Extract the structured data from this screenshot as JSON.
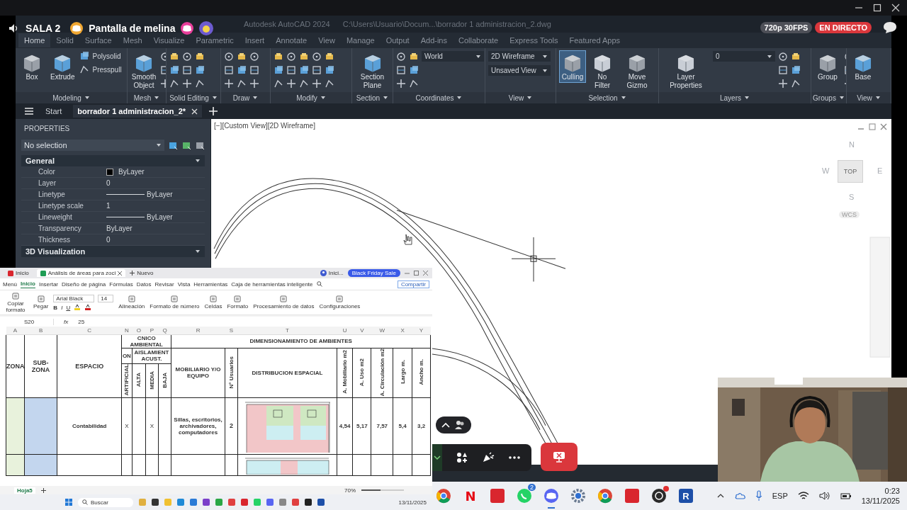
{
  "discord": {
    "room": "SALA 2",
    "stream_title": "Pantalla de melina",
    "quality": "720p 30FPS",
    "live": "EN DIRECTO"
  },
  "autocad": {
    "title": "Autodesk AutoCAD 2024",
    "path": "C:\\Users\\Usuario\\Docum...\\borrador 1 administracion_2.dwg",
    "ribbon_tabs": [
      {
        "label": "Home",
        "selected": true
      },
      {
        "label": "Solid",
        "selected": false
      },
      {
        "label": "Surface",
        "selected": false
      },
      {
        "label": "Mesh",
        "selected": false
      },
      {
        "label": "Visualize",
        "selected": false
      },
      {
        "label": "Parametric",
        "selected": false
      },
      {
        "label": "Insert",
        "selected": false
      },
      {
        "label": "Annotate",
        "selected": false
      },
      {
        "label": "View",
        "selected": false
      },
      {
        "label": "Manage",
        "selected": false
      },
      {
        "label": "Output",
        "selected": false
      },
      {
        "label": "Add-ins",
        "selected": false
      },
      {
        "label": "Collaborate",
        "selected": false
      },
      {
        "label": "Express Tools",
        "selected": false
      },
      {
        "label": "Featured Apps",
        "selected": false
      }
    ],
    "panels": [
      {
        "title": "Modeling",
        "items": [
          {
            "kind": "large",
            "label": "Box",
            "on": false
          },
          {
            "kind": "large",
            "label": "Extrude",
            "on": false
          },
          {
            "kind": "small",
            "label": "Polysolid"
          },
          {
            "kind": "small",
            "label": "Presspull"
          }
        ]
      },
      {
        "title": "Mesh",
        "items": [
          {
            "kind": "large",
            "label": "Smooth Object",
            "on": false
          },
          {
            "kind": "tools"
          }
        ]
      },
      {
        "title": "Solid Editing",
        "items": [
          {
            "kind": "tools"
          },
          {
            "kind": "tools"
          },
          {
            "kind": "tools"
          }
        ]
      },
      {
        "title": "Draw",
        "items": [
          {
            "kind": "tools"
          },
          {
            "kind": "tools"
          },
          {
            "kind": "tools"
          }
        ]
      },
      {
        "title": "Modify",
        "items": [
          {
            "kind": "tools"
          },
          {
            "kind": "tools"
          },
          {
            "kind": "tools"
          },
          {
            "kind": "tools"
          },
          {
            "kind": "tools"
          }
        ]
      },
      {
        "title": "Section",
        "items": [
          {
            "kind": "large",
            "label": "Section Plane",
            "on": false
          }
        ]
      },
      {
        "title": "Coordinates",
        "items": [
          {
            "kind": "tools"
          },
          {
            "kind": "tools"
          },
          {
            "kind": "dropdown",
            "label": "World"
          }
        ]
      },
      {
        "title": "View",
        "items": [
          {
            "kind": "dropdown",
            "label": "2D Wireframe"
          },
          {
            "kind": "dropdown",
            "label": "Unsaved View"
          }
        ]
      },
      {
        "title": "Selection",
        "items": [
          {
            "kind": "large",
            "label": "Culling",
            "on": true
          },
          {
            "kind": "large",
            "label": "No Filter",
            "on": false
          },
          {
            "kind": "large",
            "label": "Move Gizmo",
            "on": false
          }
        ]
      },
      {
        "title": "Layers",
        "items": [
          {
            "kind": "large",
            "label": "Layer Properties",
            "on": false
          },
          {
            "kind": "dropdown",
            "label": "0"
          },
          {
            "kind": "tools"
          },
          {
            "kind": "tools"
          }
        ]
      },
      {
        "title": "Groups",
        "items": [
          {
            "kind": "large",
            "label": "Group",
            "on": false
          },
          {
            "kind": "tools"
          }
        ]
      },
      {
        "title": "View",
        "items": [
          {
            "kind": "large",
            "label": "Base",
            "on": false
          }
        ]
      }
    ],
    "file_tabs": [
      {
        "label": "Start",
        "selected": false
      },
      {
        "label": "borrador 1 administracion_2*",
        "selected": true
      }
    ],
    "properties": {
      "title": "PROPERTIES",
      "selection": "No selection",
      "sections": [
        {
          "title": "General",
          "rows": [
            {
              "name": "Color",
              "value": "ByLayer",
              "kind": "swatch"
            },
            {
              "name": "Layer",
              "value": "0",
              "kind": "plain"
            },
            {
              "name": "Linetype",
              "value": "ByLayer",
              "kind": "line"
            },
            {
              "name": "Linetype scale",
              "value": "1",
              "kind": "plain"
            },
            {
              "name": "Lineweight",
              "value": "ByLayer",
              "kind": "line"
            },
            {
              "name": "Transparency",
              "value": "ByLayer",
              "kind": "plain"
            },
            {
              "name": "Thickness",
              "value": "0",
              "kind": "plain"
            }
          ]
        },
        {
          "title": "3D Visualization"
        }
      ]
    },
    "viewport": {
      "label": "[−][Custom View][2D Wireframe]",
      "compass": {
        "north": "N",
        "west": "W",
        "east": "E",
        "south": "S",
        "face": "TOP",
        "ucs": "WCS"
      }
    }
  },
  "sheet": {
    "tabs": [
      {
        "label": "Inicio",
        "selected": false
      },
      {
        "label": "Análisis de áreas para zoci",
        "selected": true
      }
    ],
    "new_tab": "Nuevo",
    "user": "Inici...",
    "promo": "Black Friday Sale",
    "menu": "Menú",
    "ribbon_tabs": [
      {
        "label": "Inicio",
        "selected": true
      },
      {
        "label": "Insertar",
        "selected": false
      },
      {
        "label": "Diseño de página",
        "selected": false
      },
      {
        "label": "Fórmulas",
        "selected": false
      },
      {
        "label": "Datos",
        "selected": false
      },
      {
        "label": "Revisar",
        "selected": false
      },
      {
        "label": "Vista",
        "selected": false
      },
      {
        "label": "Herramientas",
        "selected": false
      },
      {
        "label": "Caja de herramientas inteligente",
        "selected": false
      }
    ],
    "share": "Compartir",
    "tools": [
      {
        "kind": "tool",
        "label": "Copiar formato"
      },
      {
        "kind": "tool",
        "label": "Pegar"
      },
      {
        "kind": "font",
        "font": "Arial Black",
        "size": "14",
        "format": [
          "B",
          "I",
          "U"
        ]
      },
      {
        "kind": "tool",
        "label": "Alineación"
      },
      {
        "kind": "tool",
        "label": "Formato de número"
      },
      {
        "kind": "tool",
        "label": "Celdas"
      },
      {
        "kind": "tool",
        "label": "Formato"
      },
      {
        "kind": "tool",
        "label": "Procesamiento de datos"
      },
      {
        "kind": "tool",
        "label": "Configuraciones"
      }
    ],
    "cell_ref": "S20",
    "fx": "fx",
    "formula": "25",
    "columns": [
      "A",
      "B",
      "C",
      "N",
      "O",
      "P",
      "Q",
      "R",
      "S",
      "T",
      "U",
      "V",
      "W",
      "X",
      "Y"
    ],
    "headers": {
      "zona": "ZONA",
      "subzona": "SUB-ZONA",
      "espacio": "ESPACIO",
      "group_1": "CNICO AMBIENTAL",
      "group_2": "DIMENSIONAMIENTO DE AMBIENTES",
      "sub_1": "ON",
      "sub_2": "AISLAMIENT ACUST.",
      "vertical_1": [
        "ARTIFICIAL",
        "ALTA",
        "MEDIA",
        "BAJA"
      ],
      "mobiliario": "MOBILIARIO Y/O EQUIPO",
      "usuarios": "N° Usuarios",
      "distribucion": "DISTRIBUCION ESPACIAL",
      "vertical_2": [
        "A. Mobiliario m2",
        "A. Uso m2",
        "A. Circulación m2",
        "Largo m.",
        "Ancho m."
      ]
    },
    "rows": [
      {
        "espacio": "Contabilidad",
        "marks": {
          "N": "X",
          "P": "X"
        },
        "mobiliario": "Sillas, escritorios, archivadores, computadores",
        "usuarios": "2",
        "values": [
          "4,54",
          "5,17",
          "7,57",
          "5,4",
          "3,2"
        ]
      }
    ],
    "sheet_tab": "Hoja5",
    "zoom": "70%",
    "zoom_slider": {
      "level": 0.45
    },
    "search": "Buscar",
    "date": "13/11/2025"
  },
  "taskbar": {
    "apps": [
      {
        "kind": "chrome"
      },
      {
        "kind": "letter",
        "glyph": "N",
        "color": "#e50914"
      },
      {
        "kind": "tile",
        "color": "#d9262e"
      },
      {
        "kind": "whatsapp",
        "badge": "2"
      },
      {
        "kind": "discord"
      },
      {
        "kind": "gear"
      },
      {
        "kind": "chrome"
      },
      {
        "kind": "tile",
        "color": "#d9262e"
      },
      {
        "kind": "obs"
      },
      {
        "kind": "tile",
        "glyph": "R",
        "color": "#1d4fa8"
      }
    ],
    "language": "ESP",
    "time": "0:23",
    "date": "13/11/2025"
  }
}
